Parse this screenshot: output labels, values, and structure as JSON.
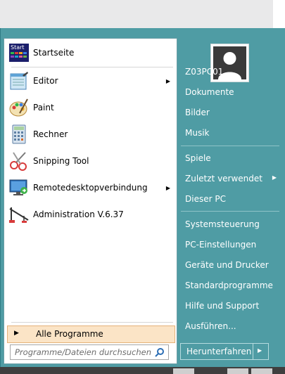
{
  "left_items": [
    {
      "label": "Startseite",
      "icon": "start-screen-icon",
      "submenu": false
    },
    {
      "label": "Editor",
      "icon": "notepad-icon",
      "submenu": true
    },
    {
      "label": "Paint",
      "icon": "paint-palette-icon",
      "submenu": false
    },
    {
      "label": "Rechner",
      "icon": "calculator-icon",
      "submenu": false
    },
    {
      "label": "Snipping Tool",
      "icon": "scissors-icon",
      "submenu": false
    },
    {
      "label": "Remotedesktopverbindung",
      "icon": "remote-desktop-icon",
      "submenu": true
    },
    {
      "label": "Administration V.6.37",
      "icon": "crane-icon",
      "submenu": false
    }
  ],
  "start_icon_text": "Start",
  "all_programs": {
    "label": "Alle Programme"
  },
  "search": {
    "placeholder": "Programme/Dateien durchsuchen"
  },
  "right_items_group1": [
    {
      "label": "Z03PC01"
    },
    {
      "label": "Dokumente"
    },
    {
      "label": "Bilder"
    },
    {
      "label": "Musik"
    }
  ],
  "right_items_group2": [
    {
      "label": "Spiele"
    },
    {
      "label": "Zuletzt verwendet",
      "submenu": true
    },
    {
      "label": "Dieser PC"
    }
  ],
  "right_items_group3": [
    {
      "label": "Systemsteuerung"
    },
    {
      "label": "PC-Einstellungen"
    },
    {
      "label": "Geräte und Drucker"
    },
    {
      "label": "Standardprogramme"
    },
    {
      "label": "Hilfe und Support"
    },
    {
      "label": "Ausführen..."
    }
  ],
  "shutdown": {
    "label": "Herunterfahren"
  },
  "colors": {
    "right_pane": "#4f9ca4",
    "all_programs_highlight": "#fbe4c6",
    "left_pane": "#ffffff"
  }
}
